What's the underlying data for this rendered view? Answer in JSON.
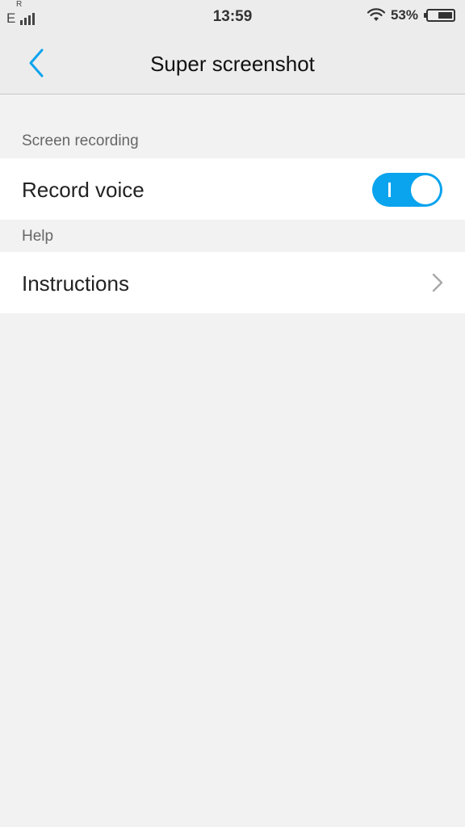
{
  "status_bar": {
    "network_type": "E",
    "roaming_mark": "R",
    "signal_icon": "signal-bars-icon",
    "time": "13:59",
    "wifi_icon": "wifi-icon",
    "battery_percent_text": "53%",
    "battery_level": 0.53
  },
  "header": {
    "back_icon": "chevron-left-icon",
    "title": "Super screenshot"
  },
  "sections": [
    {
      "header": "Screen recording",
      "items": [
        {
          "label": "Record voice",
          "control": "toggle",
          "checked": true
        }
      ]
    },
    {
      "header": "Help",
      "items": [
        {
          "label": "Instructions",
          "control": "chevron",
          "icon": "chevron-right-icon"
        }
      ]
    }
  ],
  "colors": {
    "accent": "#0aa3ee",
    "background": "#f2f2f2",
    "header_background": "#ececec",
    "row_background": "#ffffff"
  }
}
